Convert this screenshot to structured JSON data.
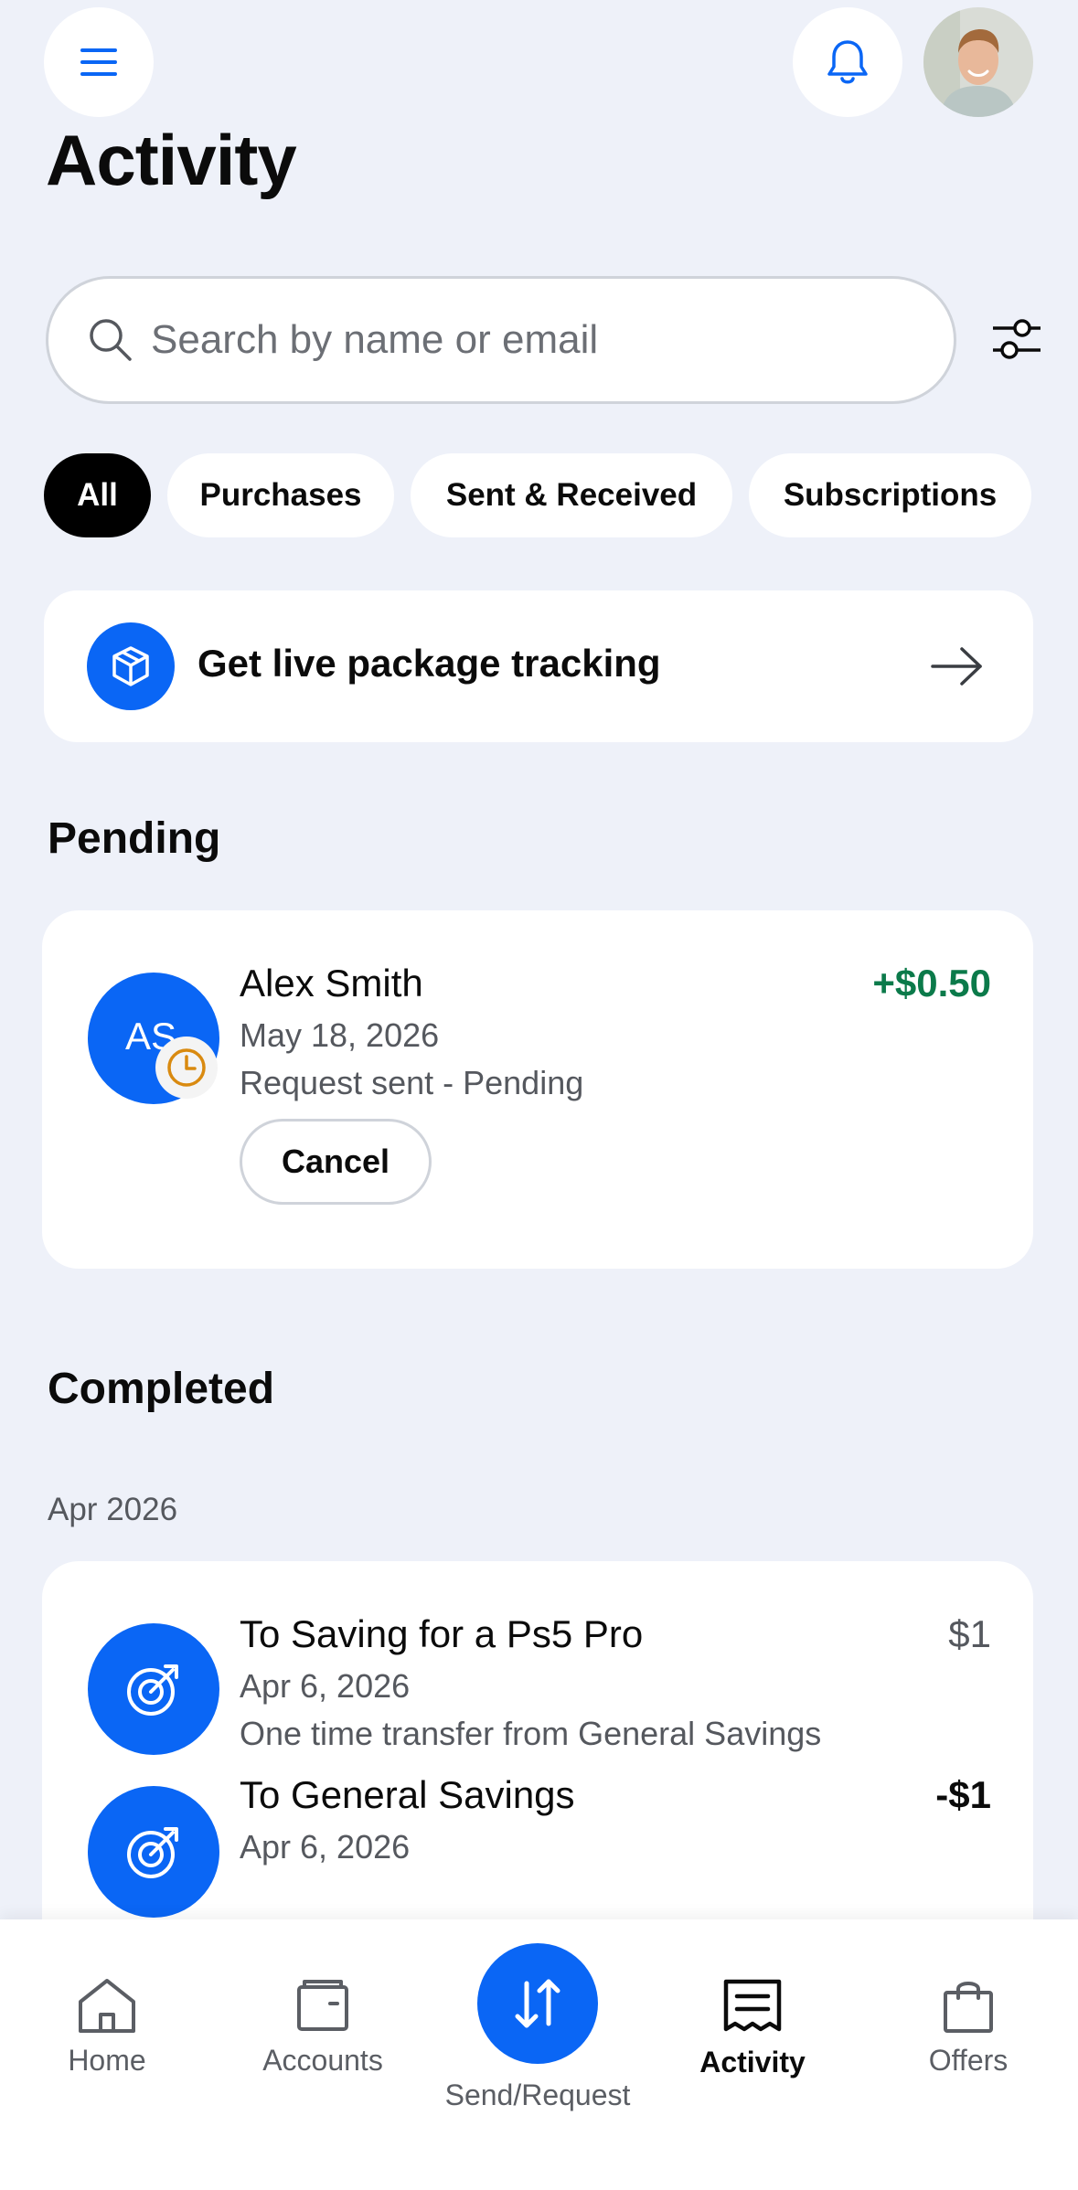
{
  "header": {
    "title": "Activity"
  },
  "search": {
    "placeholder": "Search by name or email"
  },
  "filters": {
    "chips": [
      "All",
      "Purchases",
      "Sent & Received",
      "Subscriptions"
    ],
    "selected": "All"
  },
  "promo": {
    "label": "Get live package tracking"
  },
  "pending": {
    "title": "Pending",
    "items": [
      {
        "initials": "AS",
        "name": "Alex Smith",
        "date": "May 18, 2026",
        "status": "Request sent - Pending",
        "amount": "+$0.50",
        "action": "Cancel"
      }
    ]
  },
  "completed": {
    "title": "Completed",
    "month": "Apr 2026",
    "items": [
      {
        "name": "To Saving for a Ps5 Pro",
        "date": "Apr 6, 2026",
        "detail": "One time transfer from General Savings",
        "amount": "$1"
      },
      {
        "name": "To General Savings",
        "date": "Apr 6, 2026",
        "amount": "-$1"
      }
    ]
  },
  "nav": {
    "items": [
      "Home",
      "Accounts",
      "Send/Request",
      "Activity",
      "Offers"
    ],
    "active": "Activity"
  },
  "colors": {
    "brand_blue": "#0a66f5",
    "positive_green": "#0b7a4a",
    "pending_orange": "#d98a10",
    "background": "#eef1f9"
  }
}
